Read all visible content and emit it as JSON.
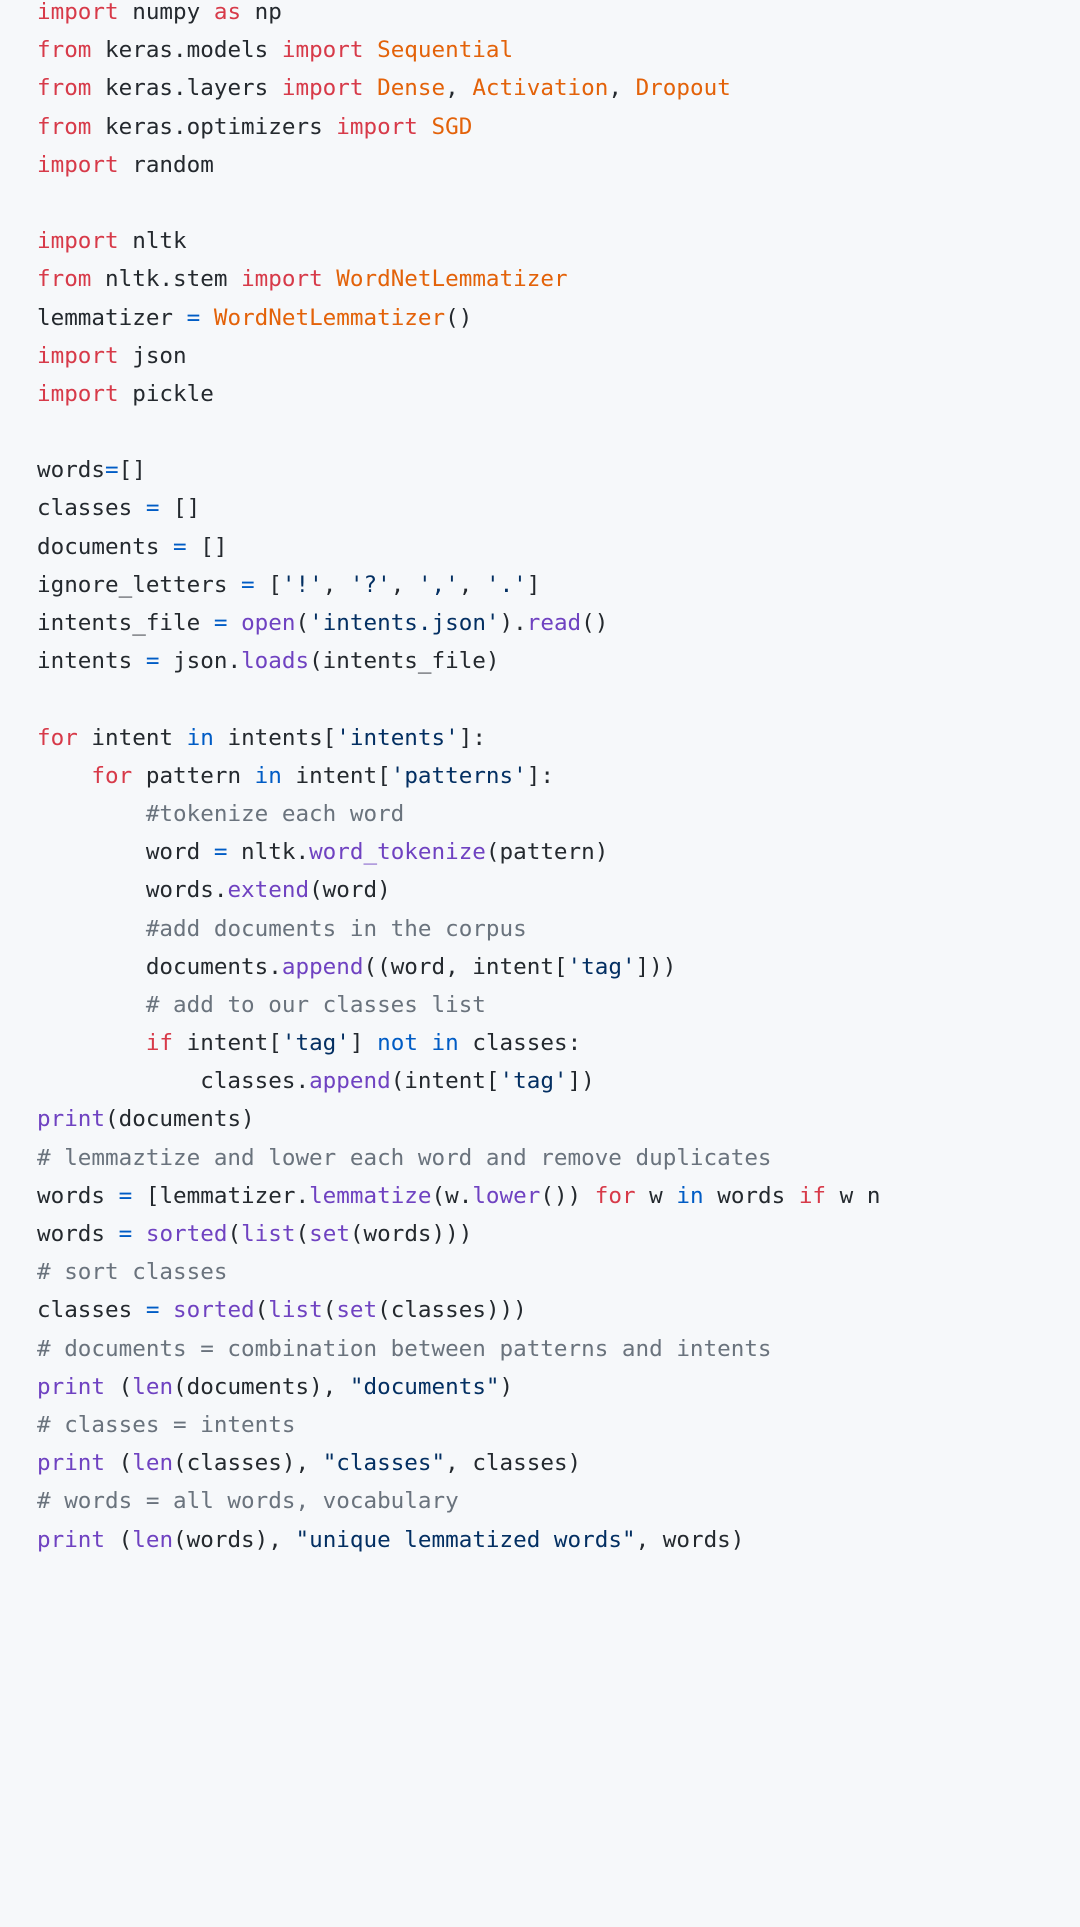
{
  "colors": {
    "keyword": "#d73a49",
    "imported_name": "#e36209",
    "string": "#032f62",
    "function": "#6f42c1",
    "operator": "#005cc5",
    "comment": "#6a737d",
    "text": "#24292e",
    "background": "#f6f8fa"
  },
  "code_lines": [
    [
      [
        "k",
        "import"
      ],
      [
        "p",
        " numpy "
      ],
      [
        "k",
        "as"
      ],
      [
        "p",
        " np"
      ]
    ],
    [
      [
        "k",
        "from"
      ],
      [
        "p",
        " keras.models "
      ],
      [
        "k",
        "import"
      ],
      [
        "p",
        " "
      ],
      [
        "t",
        "Sequential"
      ]
    ],
    [
      [
        "k",
        "from"
      ],
      [
        "p",
        " keras.layers "
      ],
      [
        "k",
        "import"
      ],
      [
        "p",
        " "
      ],
      [
        "t",
        "Dense"
      ],
      [
        "p",
        ", "
      ],
      [
        "t",
        "Activation"
      ],
      [
        "p",
        ", "
      ],
      [
        "t",
        "Dropout"
      ]
    ],
    [
      [
        "k",
        "from"
      ],
      [
        "p",
        " keras.optimizers "
      ],
      [
        "k",
        "import"
      ],
      [
        "p",
        " "
      ],
      [
        "t",
        "SGD"
      ]
    ],
    [
      [
        "k",
        "import"
      ],
      [
        "p",
        " random"
      ]
    ],
    [],
    [
      [
        "k",
        "import"
      ],
      [
        "p",
        " nltk"
      ]
    ],
    [
      [
        "k",
        "from"
      ],
      [
        "p",
        " nltk.stem "
      ],
      [
        "k",
        "import"
      ],
      [
        "p",
        " "
      ],
      [
        "t",
        "WordNetLemmatizer"
      ]
    ],
    [
      [
        "p",
        "lemmatizer "
      ],
      [
        "b",
        "="
      ],
      [
        "p",
        " "
      ],
      [
        "t",
        "WordNetLemmatizer"
      ],
      [
        "p",
        "()"
      ]
    ],
    [
      [
        "k",
        "import"
      ],
      [
        "p",
        " json"
      ]
    ],
    [
      [
        "k",
        "import"
      ],
      [
        "p",
        " pickle"
      ]
    ],
    [],
    [
      [
        "p",
        "words"
      ],
      [
        "b",
        "="
      ],
      [
        "p",
        "[]"
      ]
    ],
    [
      [
        "p",
        "classes "
      ],
      [
        "b",
        "="
      ],
      [
        "p",
        " []"
      ]
    ],
    [
      [
        "p",
        "documents "
      ],
      [
        "b",
        "="
      ],
      [
        "p",
        " []"
      ]
    ],
    [
      [
        "p",
        "ignore_letters "
      ],
      [
        "b",
        "="
      ],
      [
        "p",
        " ["
      ],
      [
        "s",
        "'!'"
      ],
      [
        "p",
        ", "
      ],
      [
        "s",
        "'?'"
      ],
      [
        "p",
        ", "
      ],
      [
        "s",
        "','"
      ],
      [
        "p",
        ", "
      ],
      [
        "s",
        "'.'"
      ],
      [
        "p",
        "]"
      ]
    ],
    [
      [
        "p",
        "intents_file "
      ],
      [
        "b",
        "="
      ],
      [
        "p",
        " "
      ],
      [
        "f",
        "open"
      ],
      [
        "p",
        "("
      ],
      [
        "s",
        "'intents.json'"
      ],
      [
        "p",
        ")."
      ],
      [
        "f",
        "read"
      ],
      [
        "p",
        "()"
      ]
    ],
    [
      [
        "p",
        "intents "
      ],
      [
        "b",
        "="
      ],
      [
        "p",
        " json."
      ],
      [
        "f",
        "loads"
      ],
      [
        "p",
        "(intents_file)"
      ]
    ],
    [],
    [
      [
        "k",
        "for"
      ],
      [
        "p",
        " intent "
      ],
      [
        "b",
        "in"
      ],
      [
        "p",
        " intents["
      ],
      [
        "s",
        "'intents'"
      ],
      [
        "p",
        "]:"
      ]
    ],
    [
      [
        "p",
        "    "
      ],
      [
        "k",
        "for"
      ],
      [
        "p",
        " pattern "
      ],
      [
        "b",
        "in"
      ],
      [
        "p",
        " intent["
      ],
      [
        "s",
        "'patterns'"
      ],
      [
        "p",
        "]:"
      ]
    ],
    [
      [
        "p",
        "        "
      ],
      [
        "c",
        "#tokenize each word"
      ]
    ],
    [
      [
        "p",
        "        word "
      ],
      [
        "b",
        "="
      ],
      [
        "p",
        " nltk."
      ],
      [
        "f",
        "word_tokenize"
      ],
      [
        "p",
        "(pattern)"
      ]
    ],
    [
      [
        "p",
        "        words."
      ],
      [
        "f",
        "extend"
      ],
      [
        "p",
        "(word)"
      ]
    ],
    [
      [
        "p",
        "        "
      ],
      [
        "c",
        "#add documents in the corpus"
      ]
    ],
    [
      [
        "p",
        "        documents."
      ],
      [
        "f",
        "append"
      ],
      [
        "p",
        "((word, intent["
      ],
      [
        "s",
        "'tag'"
      ],
      [
        "p",
        "]))"
      ]
    ],
    [
      [
        "p",
        "        "
      ],
      [
        "c",
        "# add to our classes list"
      ]
    ],
    [
      [
        "p",
        "        "
      ],
      [
        "k",
        "if"
      ],
      [
        "p",
        " intent["
      ],
      [
        "s",
        "'tag'"
      ],
      [
        "p",
        "] "
      ],
      [
        "b",
        "not"
      ],
      [
        "p",
        " "
      ],
      [
        "b",
        "in"
      ],
      [
        "p",
        " classes:"
      ]
    ],
    [
      [
        "p",
        "            classes."
      ],
      [
        "f",
        "append"
      ],
      [
        "p",
        "(intent["
      ],
      [
        "s",
        "'tag'"
      ],
      [
        "p",
        "])"
      ]
    ],
    [
      [
        "f",
        "print"
      ],
      [
        "p",
        "(documents)"
      ]
    ],
    [
      [
        "c",
        "# lemmaztize and lower each word and remove duplicates"
      ]
    ],
    [
      [
        "p",
        "words "
      ],
      [
        "b",
        "="
      ],
      [
        "p",
        " [lemmatizer."
      ],
      [
        "f",
        "lemmatize"
      ],
      [
        "p",
        "(w."
      ],
      [
        "f",
        "lower"
      ],
      [
        "p",
        "()) "
      ],
      [
        "k",
        "for"
      ],
      [
        "p",
        " w "
      ],
      [
        "b",
        "in"
      ],
      [
        "p",
        " words "
      ],
      [
        "k",
        "if"
      ],
      [
        "p",
        " w n"
      ]
    ],
    [
      [
        "p",
        "words "
      ],
      [
        "b",
        "="
      ],
      [
        "p",
        " "
      ],
      [
        "f",
        "sorted"
      ],
      [
        "p",
        "("
      ],
      [
        "f",
        "list"
      ],
      [
        "p",
        "("
      ],
      [
        "f",
        "set"
      ],
      [
        "p",
        "(words)))"
      ]
    ],
    [
      [
        "c",
        "# sort classes"
      ]
    ],
    [
      [
        "p",
        "classes "
      ],
      [
        "b",
        "="
      ],
      [
        "p",
        " "
      ],
      [
        "f",
        "sorted"
      ],
      [
        "p",
        "("
      ],
      [
        "f",
        "list"
      ],
      [
        "p",
        "("
      ],
      [
        "f",
        "set"
      ],
      [
        "p",
        "(classes)))"
      ]
    ],
    [
      [
        "c",
        "# documents = combination between patterns and intents"
      ]
    ],
    [
      [
        "f",
        "print"
      ],
      [
        "p",
        " ("
      ],
      [
        "f",
        "len"
      ],
      [
        "p",
        "(documents), "
      ],
      [
        "s",
        "\"documents\""
      ],
      [
        "p",
        ")"
      ]
    ],
    [
      [
        "c",
        "# classes = intents"
      ]
    ],
    [
      [
        "f",
        "print"
      ],
      [
        "p",
        " ("
      ],
      [
        "f",
        "len"
      ],
      [
        "p",
        "(classes), "
      ],
      [
        "s",
        "\"classes\""
      ],
      [
        "p",
        ", classes)"
      ]
    ],
    [
      [
        "c",
        "# words = all words, vocabulary"
      ]
    ],
    [
      [
        "f",
        "print"
      ],
      [
        "p",
        " ("
      ],
      [
        "f",
        "len"
      ],
      [
        "p",
        "(words), "
      ],
      [
        "s",
        "\"unique lemmatized words\""
      ],
      [
        "p",
        ", words)"
      ]
    ]
  ]
}
